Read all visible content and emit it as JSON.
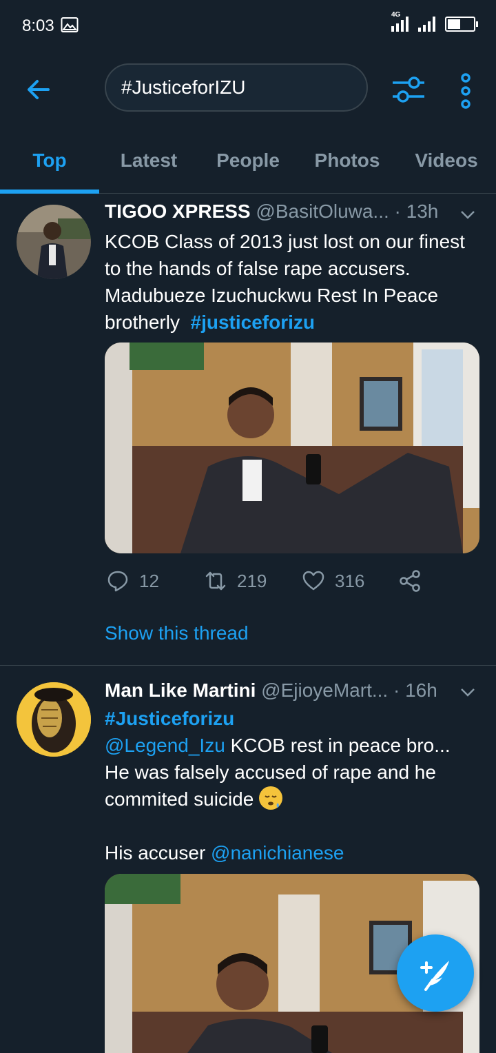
{
  "status_bar": {
    "time": "8:03",
    "network": "4G"
  },
  "header": {
    "search_value": "#JusticeforIZU"
  },
  "tabs": [
    {
      "label": "Top",
      "active": true
    },
    {
      "label": "Latest",
      "active": false
    },
    {
      "label": "People",
      "active": false
    },
    {
      "label": "Photos",
      "active": false
    },
    {
      "label": "Videos",
      "active": false
    }
  ],
  "tweets": [
    {
      "name": "TIGOO XPRESS",
      "handle": "@BasitOluwa...",
      "time": "· 13h",
      "text": "KCOB Class of 2013 just lost on our finest to the hands of false rape accusers. Madubueze Izuchuckwu Rest In Peace brotherly",
      "hashtag": "#justiceforizu",
      "replies": "12",
      "retweets": "219",
      "likes": "316",
      "show_thread": "Show this thread"
    },
    {
      "name": "Man Like Martini",
      "handle": "@EjioyeMart...",
      "time": "· 16h",
      "hashtag": "#Justiceforizu",
      "mention": "@Legend_Izu",
      "text": "KCOB rest in peace bro... He was falsely accused of rape and he commited suicide",
      "accuser_label": "His accuser",
      "accuser_mention": "@nanichianese"
    }
  ],
  "colors": {
    "background": "#15202b",
    "accent": "#1da1f2",
    "muted": "#8899a6",
    "divider": "#38444d"
  }
}
